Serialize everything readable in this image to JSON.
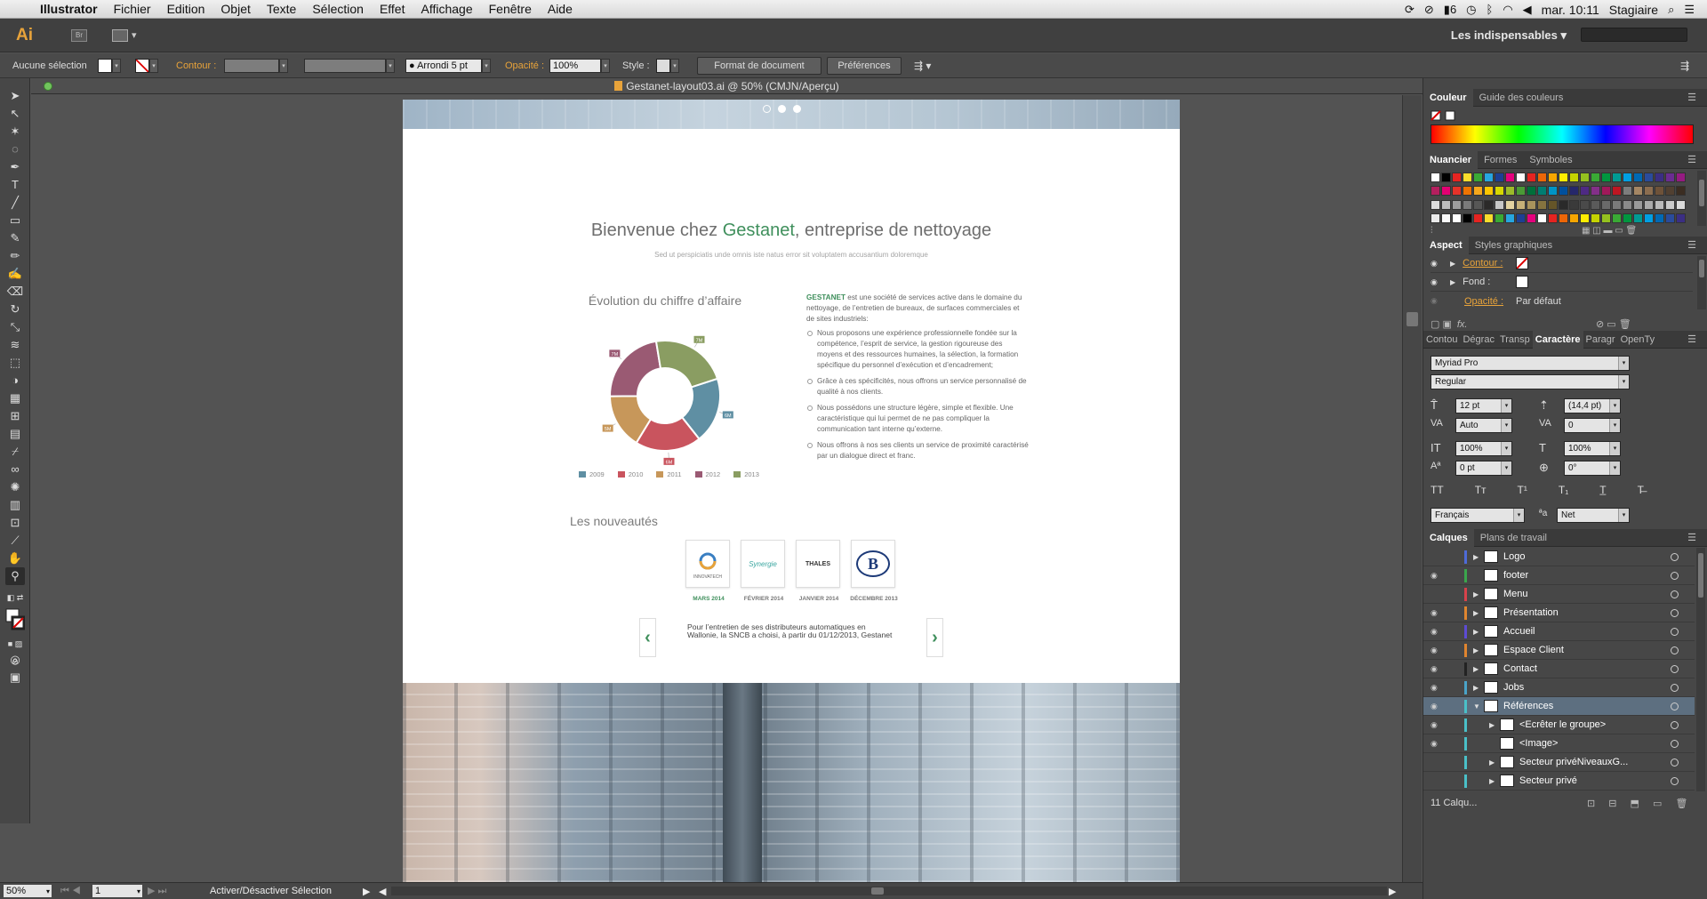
{
  "menubar": {
    "app": "Illustrator",
    "items": [
      "Fichier",
      "Edition",
      "Objet",
      "Texte",
      "Sélection",
      "Effet",
      "Affichage",
      "Fenêtre",
      "Aide"
    ],
    "battery": "6",
    "clock": "mar. 10:11",
    "user": "Stagiaire"
  },
  "appbar": {
    "logo": "Ai",
    "bridge": "Br",
    "workspace": "Les indispensables"
  },
  "control": {
    "selection": "Aucune sélection",
    "contour_label": "Contour :",
    "brush": "Arrondi 5 pt",
    "opacity_label": "Opacité :",
    "opacity_value": "100%",
    "style_label": "Style :",
    "doc_setup": "Format de document",
    "prefs": "Préférences"
  },
  "document": {
    "title": "Gestanet-layout03.ai @ 50% (CMJN/Aperçu)"
  },
  "artboard": {
    "welcome_prefix": "Bienvenue chez ",
    "welcome_brand": "Gestanet",
    "welcome_suffix": ", entreprise de nettoyage",
    "subtitle": "Sed ut perspiciatis unde omnis iste natus error sit voluptatem accusantium doloremque",
    "chart_title": "Évolution du chiffre d’affaire",
    "intro_brand": "GESTANET",
    "intro_text": " est une société de services active dans le domaine du nettoyage, de l’entretien de bureaux, de surfaces commerciales et de sites industriels:",
    "bullets": [
      "Nous proposons une expérience professionnelle fondée sur la compétence, l’esprit de service, la gestion rigoureuse des moyens et des ressources humaines, la sélection, la formation spécifique du personnel d’exécution et d’encadrement;",
      "Grâce à ces spécificités, nous offrons un service personnalisé de qualité à nos clients.",
      "Nous possédons une structure légère, simple et flexible. Une caractéristique qui lui permet de ne pas compliquer la communication tant interne qu’externe.",
      "Nous offrons à nos ses clients un service de proximité caractérisé par un dialogue direct et franc."
    ],
    "news_title": "Les nouveautés",
    "logos": [
      {
        "name": "INNOVATECH",
        "date": "MARS 2014"
      },
      {
        "name": "Synergie",
        "date": "FÉVRIER 2014"
      },
      {
        "name": "THALES",
        "date": "JANVIER 2014"
      },
      {
        "name": "B",
        "date": "DÉCEMBRE 2013"
      }
    ],
    "quote": "Pour l’entretien de ses distributeurs automatiques en Wallonie, la SNCB a choisi, à partir du 01/12/2013, Gestanet"
  },
  "chart_data": {
    "type": "pie",
    "categories": [
      "2009",
      "2010",
      "2011",
      "2012",
      "2013"
    ],
    "values": [
      6,
      6,
      5,
      7,
      7
    ],
    "labels": [
      "6M",
      "6M",
      "5M",
      "7M",
      "7M"
    ],
    "colors": [
      "#5f8fa3",
      "#c9545e",
      "#c7975a",
      "#9a5a73",
      "#8a9d62"
    ]
  },
  "panels": {
    "color_tabs": [
      "Couleur",
      "Guide des couleurs"
    ],
    "swatch_tabs": [
      "Nuancier",
      "Formes",
      "Symboles"
    ],
    "aspect_tabs": [
      "Aspect",
      "Styles graphiques"
    ],
    "aspect_rows": {
      "contour": "Contour :",
      "fond": "Fond :",
      "opacity": "Opacité :",
      "opacity_value": "Par défaut"
    },
    "char_tabs": [
      "Contou",
      "Dégrac",
      "Transp",
      "Caractère",
      "Paragr",
      "OpenTy"
    ],
    "font_family": "Myriad Pro",
    "font_style": "Regular",
    "size": "12 pt",
    "leading": "(14,4 pt)",
    "kerning": "Auto",
    "tracking": "0",
    "vscale": "100%",
    "hscale": "100%",
    "baseline": "0 pt",
    "rotation": "0°",
    "language": "Français",
    "aa": "Net",
    "layers_tabs": [
      "Calques",
      "Plans de travail"
    ],
    "layers": [
      {
        "name": "Logo",
        "eye": false,
        "color": "#4e6bd8",
        "tri": "▶",
        "indent": 0,
        "sel": false
      },
      {
        "name": "footer",
        "eye": true,
        "color": "#3aa64c",
        "tri": "",
        "indent": 0,
        "sel": false
      },
      {
        "name": "Menu",
        "eye": false,
        "color": "#d8424b",
        "tri": "▶",
        "indent": 0,
        "sel": false
      },
      {
        "name": "Présentation",
        "eye": true,
        "color": "#e0862f",
        "tri": "▶",
        "indent": 0,
        "sel": false
      },
      {
        "name": "Accueil",
        "eye": true,
        "color": "#5d4bd4",
        "tri": "▶",
        "indent": 0,
        "sel": false
      },
      {
        "name": "Espace Client",
        "eye": true,
        "color": "#e0852f",
        "tri": "▶",
        "indent": 0,
        "sel": false
      },
      {
        "name": "Contact",
        "eye": true,
        "color": "#222222",
        "tri": "▶",
        "indent": 0,
        "sel": false
      },
      {
        "name": "Jobs",
        "eye": true,
        "color": "#4aa3c8",
        "tri": "▶",
        "indent": 0,
        "sel": false
      },
      {
        "name": "Références",
        "eye": true,
        "color": "#4ac0c8",
        "tri": "▼",
        "indent": 0,
        "sel": true
      },
      {
        "name": "<Ecrêter le groupe>",
        "eye": true,
        "color": "#4ac0c8",
        "tri": "▶",
        "indent": 1,
        "sel": false
      },
      {
        "name": "<Image>",
        "eye": true,
        "color": "#4ac0c8",
        "tri": "",
        "indent": 1,
        "sel": false
      },
      {
        "name": "Secteur privéNiveauxG...",
        "eye": false,
        "color": "#4ac0c8",
        "tri": "▶",
        "indent": 1,
        "sel": false
      },
      {
        "name": "Secteur privé",
        "eye": false,
        "color": "#4ac0c8",
        "tri": "▶",
        "indent": 1,
        "sel": false
      }
    ],
    "layers_count": "11 Calqu..."
  },
  "status": {
    "zoom": "50%",
    "page": "1",
    "tool": "Activer/Désactiver Sélection"
  }
}
